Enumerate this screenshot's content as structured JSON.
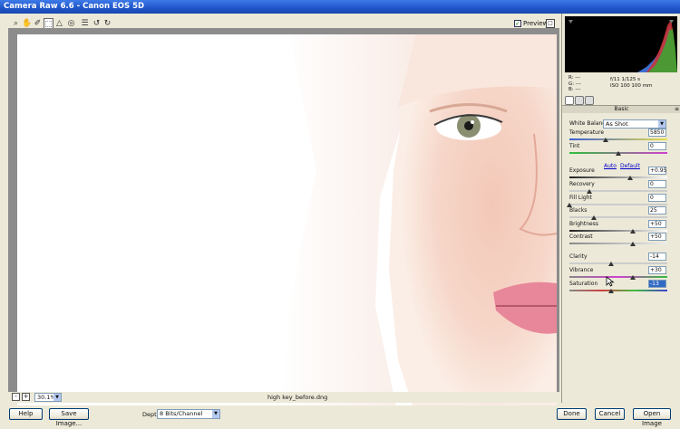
{
  "app": {
    "title": "Camera Raw 6.6  -  Canon EOS 5D"
  },
  "toolbar": {
    "tools": [
      "zoom-icon",
      "hand-icon",
      "white-balance-icon",
      "crop-icon",
      "straighten-icon",
      "spot-removal-icon",
      "preferences-icon",
      "rotate-left-icon",
      "rotate-right-icon"
    ],
    "preview_label": "Preview",
    "preview_checked": true
  },
  "status": {
    "zoom": "30.1%",
    "filename": "high key_before.dng"
  },
  "footer": {
    "help": "Help",
    "save": "Save Image...",
    "depth_label": "Depth:",
    "depth_value": "8 Bits/Channel",
    "done": "Done",
    "cancel": "Cancel",
    "open": "Open Image"
  },
  "readout": {
    "r": "R:  ---",
    "g": "G:  ---",
    "b": "B:  ---",
    "cam1": "f/11     1/125 s",
    "cam2": "ISO 100    100 mm"
  },
  "panel": {
    "section": "Basic",
    "wb_label": "White Balance:",
    "wb_value": "As Shot",
    "auto": "Auto",
    "default": "Default",
    "sliders": [
      {
        "label": "Temperature",
        "value": "5850",
        "level": 0.37
      },
      {
        "label": "Tint",
        "value": "0",
        "level": 0.5
      },
      {
        "label": "Exposure",
        "value": "+0.95",
        "level": 0.62
      },
      {
        "label": "Recovery",
        "value": "0",
        "level": 0.2
      },
      {
        "label": "Fill Light",
        "value": "0",
        "level": 0.0
      },
      {
        "label": "Blacks",
        "value": "25",
        "level": 0.25
      },
      {
        "label": "Brightness",
        "value": "+50",
        "level": 0.65
      },
      {
        "label": "Contrast",
        "value": "+50",
        "level": 0.65
      },
      {
        "label": "Clarity",
        "value": "-14",
        "level": 0.43
      },
      {
        "label": "Vibrance",
        "value": "+30",
        "level": 0.65
      },
      {
        "label": "Saturation",
        "value": "-13",
        "level": 0.43
      }
    ]
  },
  "colors": {
    "accent": "#316ac5",
    "title_bar": "#1f55c9",
    "panel_bg": "#ece9d8"
  }
}
